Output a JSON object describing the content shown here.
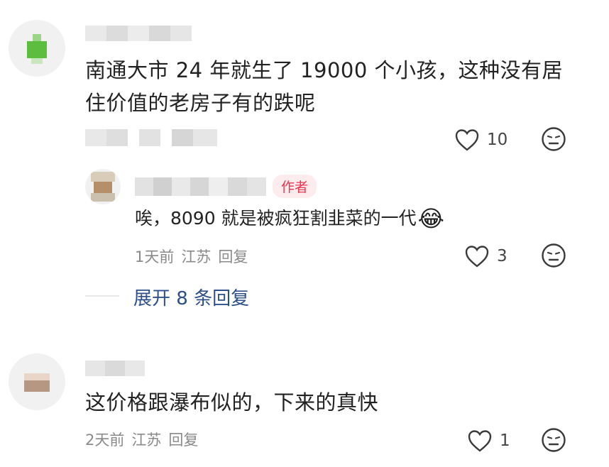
{
  "comments": [
    {
      "text_line1": "南通大市 24 年就生了 19000 个小孩，这种没有居",
      "text_line2": "住价值的老房子有的跌呢",
      "likes": "10"
    },
    {
      "author_tag": "作者",
      "text": "唉，8090 就是被疯狂割韭菜的一代",
      "meta_time": "1天前",
      "meta_location": "江苏",
      "meta_reply": "回复",
      "likes": "3",
      "emoji": "😂"
    },
    {
      "text": "这价格跟瀑布似的，下来的真快",
      "meta_time": "2天前",
      "meta_location": "江苏",
      "meta_reply": "回复",
      "likes": "1"
    }
  ],
  "expand_replies": "展开 8 条回复",
  "icons": {
    "like": "heart-icon",
    "dislike": "neutral-face-icon"
  }
}
